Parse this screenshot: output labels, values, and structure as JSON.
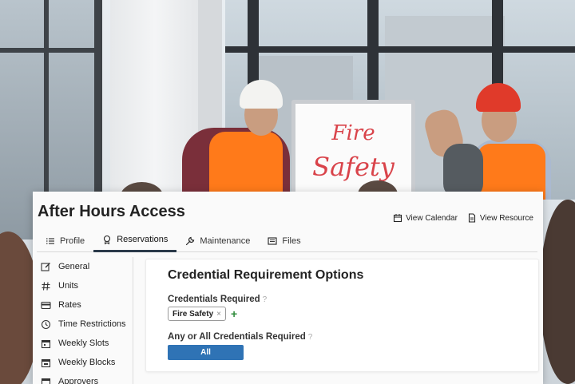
{
  "photo": {
    "board_text_line1": "Fire",
    "board_text_line2": "Safety"
  },
  "page": {
    "title": "After Hours Access"
  },
  "top_links": [
    {
      "label": "View Calendar",
      "icon": "calendar-icon"
    },
    {
      "label": "View Resource",
      "icon": "document-icon"
    }
  ],
  "tabs": [
    {
      "label": "Profile",
      "icon": "list-icon"
    },
    {
      "label": "Reservations",
      "icon": "tag-icon",
      "active": true
    },
    {
      "label": "Maintenance",
      "icon": "wrench-icon"
    },
    {
      "label": "Files",
      "icon": "files-icon"
    }
  ],
  "sidebar": {
    "items": [
      {
        "label": "General",
        "icon": "edit-icon"
      },
      {
        "label": "Units",
        "icon": "hash-icon"
      },
      {
        "label": "Rates",
        "icon": "card-icon"
      },
      {
        "label": "Time Restrictions",
        "icon": "clock-icon"
      },
      {
        "label": "Weekly Slots",
        "icon": "calendar-icon"
      },
      {
        "label": "Weekly Blocks",
        "icon": "calendar-icon"
      },
      {
        "label": "Approvers",
        "icon": "calendar-icon"
      }
    ]
  },
  "panel": {
    "title": "Credential Requirement Options",
    "credentials_label": "Credentials Required",
    "help_glyph": "?",
    "credential_chip": "Fire Safety",
    "chip_remove": "×",
    "add_glyph": "+",
    "any_all_label": "Any or All Credentials Required",
    "any_all_value": "All"
  },
  "colors": {
    "primary_button": "#2f73b5",
    "add_green": "#2e8b3a",
    "active_tab_underline": "#2b3a4a"
  }
}
